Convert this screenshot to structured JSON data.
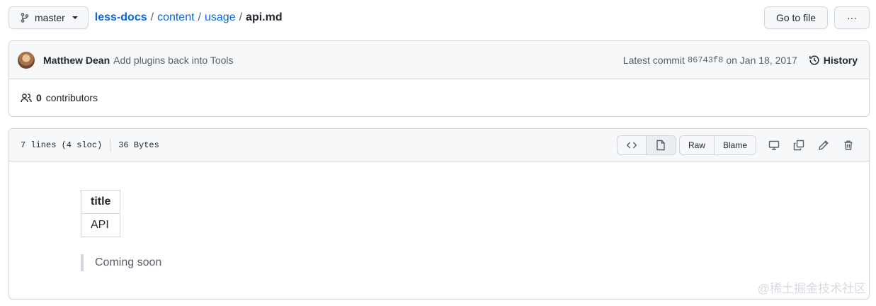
{
  "topbar": {
    "branch": "master",
    "breadcrumb": {
      "repo": "less-docs",
      "sep1": "/",
      "dir1": "content",
      "sep2": "/",
      "dir2": "usage",
      "sep3": "/",
      "file": "api.md"
    },
    "go_to_file_label": "Go to file",
    "more_label": "···"
  },
  "commit": {
    "author": "Matthew Dean",
    "message": "Add plugins back into Tools",
    "latest_label": "Latest commit",
    "sha": "86743f8",
    "date": "on Jan 18, 2017",
    "history_label": "History"
  },
  "contributors": {
    "count": "0",
    "label": "contributors"
  },
  "file": {
    "lines": "7 lines (4 sloc)",
    "size": "36 Bytes",
    "raw_label": "Raw",
    "blame_label": "Blame"
  },
  "content": {
    "table_header": "title",
    "table_cell": "API",
    "blockquote": "Coming soon"
  },
  "watermark": "@稀土掘金技术社区"
}
